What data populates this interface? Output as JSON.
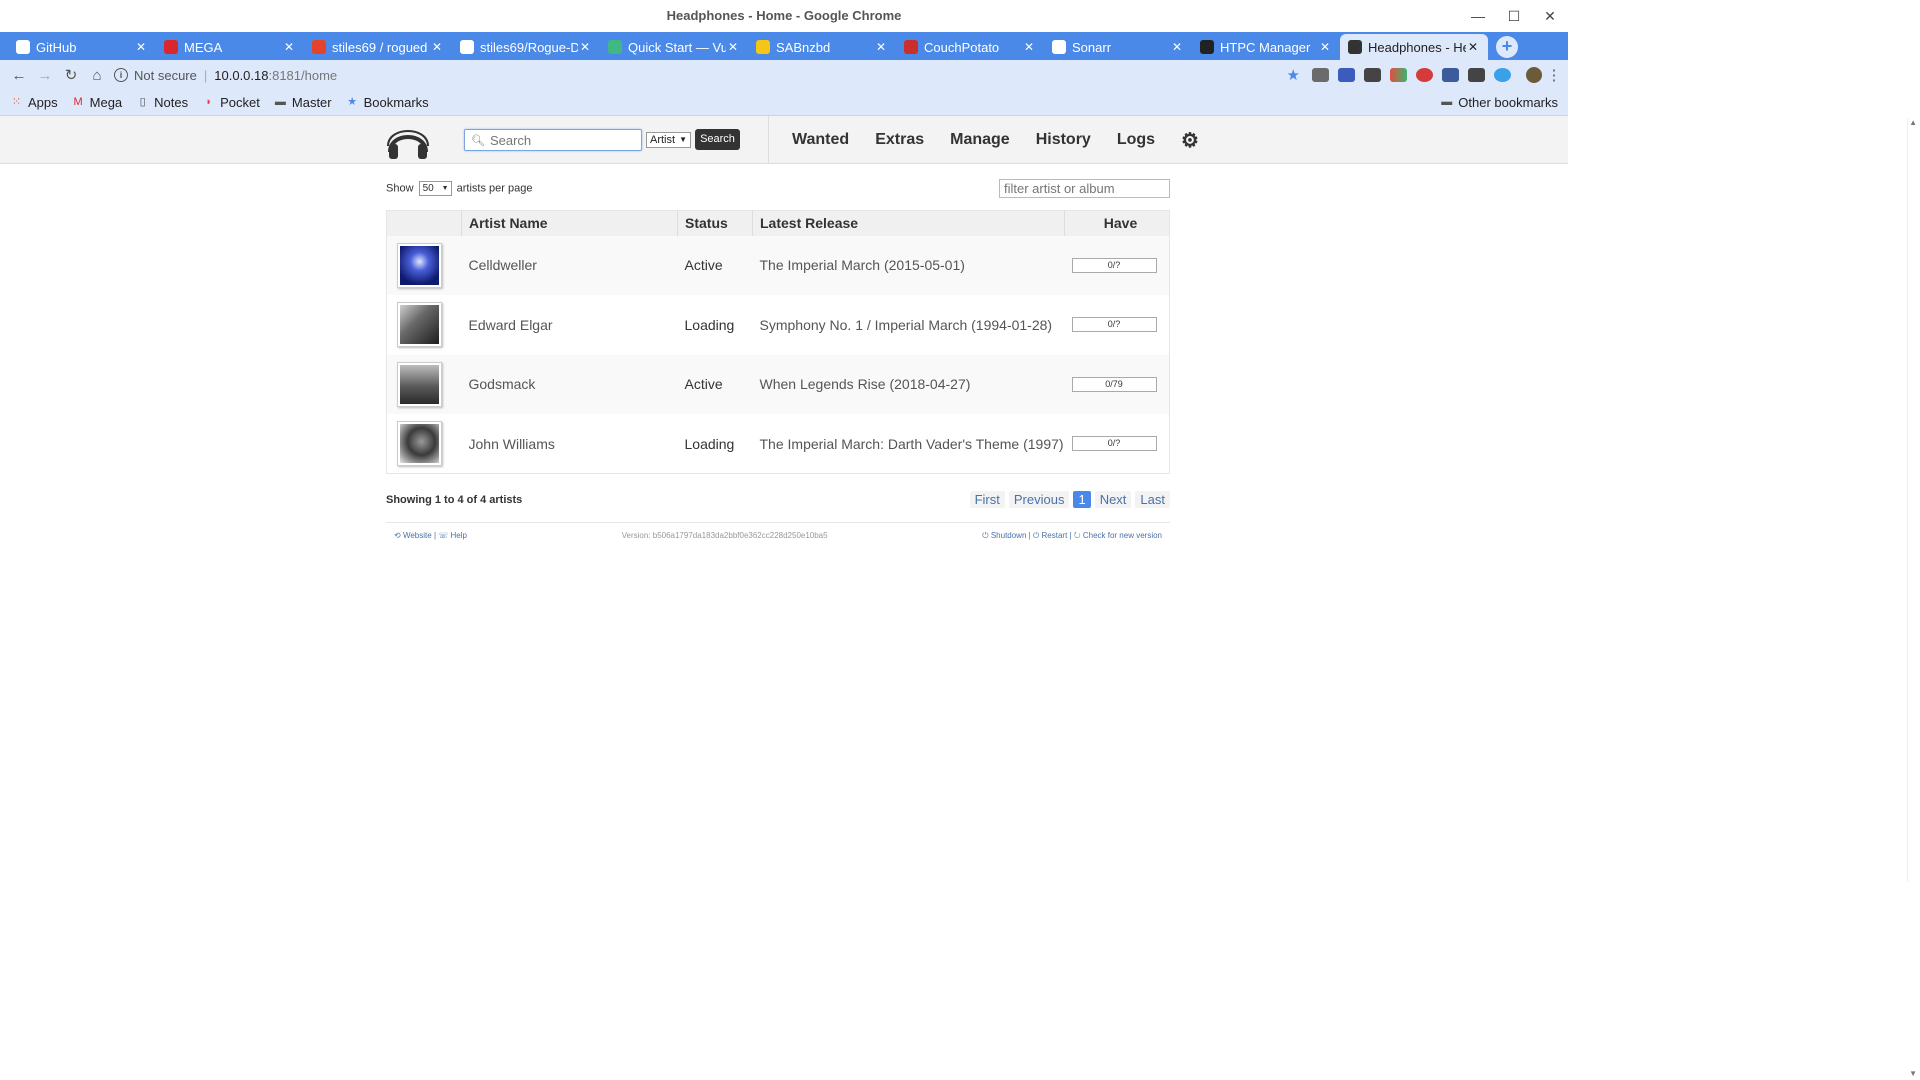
{
  "window": {
    "title": "Headphones - Home - Google Chrome",
    "min": "—",
    "max": "☐",
    "close": "✕"
  },
  "tabs": [
    {
      "label": "GitHub",
      "icon": "github-icon",
      "color": "#ffffff"
    },
    {
      "label": "MEGA",
      "icon": "mega-icon",
      "color": "#d9272e"
    },
    {
      "label": "stiles69 / rogued",
      "icon": "gitlab-icon",
      "color": "#e24329"
    },
    {
      "label": "stiles69/Rogue-D",
      "icon": "github-icon",
      "color": "#ffffff"
    },
    {
      "label": "Quick Start — Vu",
      "icon": "vue-icon",
      "color": "#41b883"
    },
    {
      "label": "SABnzbd",
      "icon": "sabnzbd-icon",
      "color": "#f5c518"
    },
    {
      "label": "CouchPotato",
      "icon": "couchpotato-icon",
      "color": "#c9302c"
    },
    {
      "label": "Sonarr",
      "icon": "sonarr-icon",
      "color": "#ffffff"
    },
    {
      "label": "HTPC Manager",
      "icon": "htpc-icon",
      "color": "#222222"
    },
    {
      "label": "Headphones - He",
      "icon": "headphones-icon",
      "color": "#333333"
    }
  ],
  "address": {
    "security": "Not secure",
    "host": "10.0.0.18",
    "path": ":8181/home"
  },
  "bookmarks": {
    "items": [
      {
        "label": "Apps",
        "icon": "apps-grid-icon",
        "color": "#e0503c"
      },
      {
        "label": "Mega",
        "icon": "mega-icon",
        "color": "#d9272e"
      },
      {
        "label": "Notes",
        "icon": "page-icon",
        "color": "#555555"
      },
      {
        "label": "Pocket",
        "icon": "pocket-icon",
        "color": "#ef4056"
      },
      {
        "label": "Master",
        "icon": "folder-icon",
        "color": "#555555"
      },
      {
        "label": "Bookmarks",
        "icon": "star-icon",
        "color": "#4a89e8"
      }
    ],
    "other": "Other bookmarks"
  },
  "app": {
    "search_placeholder": "Search",
    "search_type": "Artist",
    "search_button": "Search",
    "nav": [
      "Wanted",
      "Extras",
      "Manage",
      "History",
      "Logs"
    ],
    "show_prefix": "Show",
    "page_length": "50",
    "show_suffix": "artists per page",
    "filter_placeholder": "filter artist or album",
    "columns": [
      "",
      "Artist Name",
      "Status",
      "Latest Release",
      "Have"
    ],
    "artists": [
      {
        "name": "Celldweller",
        "status": "Active",
        "release": "The Imperial March (2015-05-01)",
        "have": "0/?",
        "art": "celldweller-art"
      },
      {
        "name": "Edward Elgar",
        "status": "Loading",
        "release": "Symphony No. 1 / Imperial March (1994-01-28)",
        "have": "0/?",
        "art": "elgar-art"
      },
      {
        "name": "Godsmack",
        "status": "Active",
        "release": "When Legends Rise (2018-04-27)",
        "have": "0/79",
        "art": "godsmack-art"
      },
      {
        "name": "John Williams",
        "status": "Loading",
        "release": "The Imperial March: Darth Vader's Theme (1997)",
        "have": "0/?",
        "art": "williams-art"
      }
    ],
    "showing": "Showing 1 to 4 of 4 artists",
    "pager": {
      "first": "First",
      "previous": "Previous",
      "current": "1",
      "next": "Next",
      "last": "Last"
    },
    "footer": {
      "website": "Website",
      "help": "Help",
      "version": "Version: b506a1797da183da2bbf0e362cc228d250e10ba5",
      "shutdown": "Shutdown",
      "restart": "Restart",
      "check": "Check for new version"
    }
  }
}
